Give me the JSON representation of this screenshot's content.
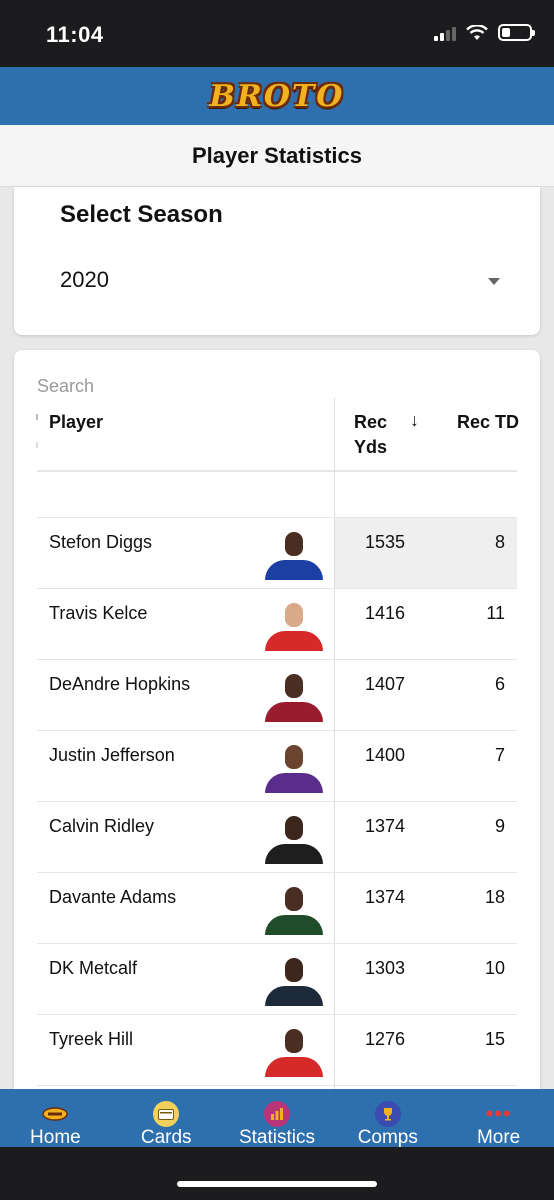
{
  "status_bar": {
    "time": "11:04"
  },
  "header": {
    "logo_text": "BROTO"
  },
  "page": {
    "title": "Player Statistics"
  },
  "season": {
    "label": "Select Season",
    "selected": "2020"
  },
  "search": {
    "placeholder": "Search"
  },
  "table": {
    "columns": {
      "player": "Player",
      "rec_yds": "Rec Yds",
      "rec_td": "Rec TD"
    },
    "sort": {
      "column": "rec_yds",
      "direction": "desc",
      "icon": "arrow-down-icon"
    },
    "rows": [
      {
        "player": "Stefon Diggs",
        "rec_yds": "1535",
        "rec_td": "8",
        "skin": "#4a2e22",
        "jersey": "#1c3fa3"
      },
      {
        "player": "Travis Kelce",
        "rec_yds": "1416",
        "rec_td": "11",
        "skin": "#d9a98a",
        "jersey": "#d62a2a"
      },
      {
        "player": "DeAndre Hopkins",
        "rec_yds": "1407",
        "rec_td": "6",
        "skin": "#4a2e22",
        "jersey": "#9b1b2e"
      },
      {
        "player": "Justin Jefferson",
        "rec_yds": "1400",
        "rec_td": "7",
        "skin": "#6b4430",
        "jersey": "#5a2d8c"
      },
      {
        "player": "Calvin Ridley",
        "rec_yds": "1374",
        "rec_td": "9",
        "skin": "#3d261c",
        "jersey": "#1e1e1e"
      },
      {
        "player": "Davante Adams",
        "rec_yds": "1374",
        "rec_td": "18",
        "skin": "#4a2e22",
        "jersey": "#1f4d2b"
      },
      {
        "player": "DK Metcalf",
        "rec_yds": "1303",
        "rec_td": "10",
        "skin": "#3d261c",
        "jersey": "#1c2a3a"
      },
      {
        "player": "Tyreek Hill",
        "rec_yds": "1276",
        "rec_td": "15",
        "skin": "#4a2e22",
        "jersey": "#d62a2a"
      }
    ]
  },
  "tabs": [
    {
      "label": "Home",
      "icon": "broto-logo-icon",
      "icon_color": "#f2b21f"
    },
    {
      "label": "Cards",
      "icon": "card-icon",
      "icon_color": "#f2d15a"
    },
    {
      "label": "Statistics",
      "icon": "bar-chart-icon",
      "icon_color": "#b8357a"
    },
    {
      "label": "Comps",
      "icon": "trophy-icon",
      "icon_color": "#3b4bb0"
    },
    {
      "label": "More",
      "icon": "more-dots-icon",
      "icon_color": "#e53935"
    }
  ]
}
